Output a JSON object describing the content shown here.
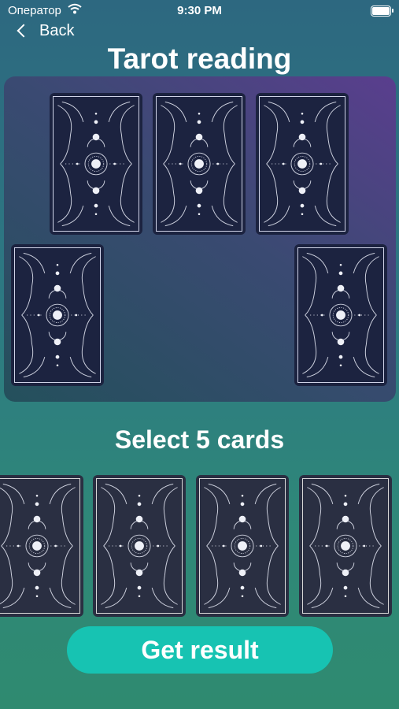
{
  "status_bar": {
    "carrier": "Оператор",
    "time": "9:30 PM"
  },
  "nav": {
    "back_label": "Back"
  },
  "title": "Tarot reading",
  "board": {
    "selected_cards": 5
  },
  "deck": {
    "instruction": "Select 5 cards",
    "visible_cards": 4
  },
  "actions": {
    "result_button": "Get result"
  },
  "colors": {
    "accent": "#17c3b2",
    "card_dark": "#2a2f42",
    "card_blue": "#1c2340"
  }
}
